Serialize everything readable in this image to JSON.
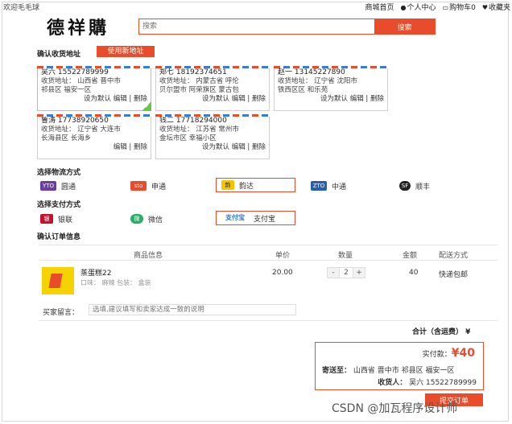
{
  "topbar": {
    "welcome": "欢迎毛毛球",
    "links": [
      "商城首页",
      "个人中心",
      "购物车0",
      "收藏夹"
    ]
  },
  "header": {
    "logo": "德祥購",
    "search_placeholder": "搜索",
    "search_button": "搜索"
  },
  "address": {
    "title": "确认收货地址",
    "new_button": "使用新地址",
    "cards": [
      {
        "name": "吴六 15522789999",
        "line1": "收货地址： 山西省 晋中市",
        "line2": "祁县区 福安一区",
        "actions": [
          "设为默认",
          "编辑",
          "删除"
        ]
      },
      {
        "name": "郑七 18192374651",
        "line1": "收货地址： 内蒙古省 呼伦",
        "line2": "贝尔盟市 阿荣旗区 蒙古包",
        "actions": [
          "设为默认",
          "编辑",
          "删除"
        ]
      },
      {
        "name": "赵一 13145227890",
        "line1": "收货地址： 辽宁省 沈阳市",
        "line2": "铁西区区 和乐苑",
        "actions": [
          "设为默认",
          "编辑",
          "删除"
        ]
      },
      {
        "name": "鲁涛 17738920650",
        "line1": "收货地址： 辽宁省 大连市",
        "line2": "长海县区 长海乡",
        "actions": [
          "编辑",
          "删除"
        ]
      },
      {
        "name": "钱二 17718294000",
        "line1": "收货地址： 江苏省 常州市",
        "line2": "金坛市区 幸福小区",
        "actions": [
          "设为默认",
          "编辑",
          "删除"
        ]
      }
    ]
  },
  "shipping": {
    "title": "选择物流方式",
    "options": [
      {
        "icon": "YTO",
        "label": "圆通",
        "color": "#6b3fa0"
      },
      {
        "icon": "sto",
        "label": "申通",
        "color": "#e84c2b"
      },
      {
        "icon": "韵",
        "label": "韵达",
        "color": "#f5c400"
      },
      {
        "icon": "ZTO",
        "label": "中通",
        "color": "#2a5db0"
      },
      {
        "icon": "SF",
        "label": "顺丰",
        "color": "#222222"
      }
    ]
  },
  "payment": {
    "title": "选择支付方式",
    "options": [
      {
        "icon": "银",
        "label": "银联",
        "color": "#c8102e"
      },
      {
        "icon": "微",
        "label": "微信",
        "color": "#2aae67"
      },
      {
        "icon": "支付宝",
        "label": "支付宝",
        "color": "#1677ff"
      }
    ]
  },
  "order": {
    "title": "确认订单信息",
    "columns": [
      "商品信息",
      "单价",
      "数量",
      "金额",
      "配送方式"
    ],
    "item": {
      "name": "蒸蛋糕22",
      "attrs": "口味： 麻辣 包装： 盒装",
      "price": "20.00",
      "qty": "2",
      "minus": "-",
      "plus": "+",
      "amount": "40",
      "shipping": "快递包邮"
    },
    "message_label": "买家留言：",
    "message_placeholder": "选填,建议填写和卖家达成一致的说明",
    "total_label": "合计（含运费）  ¥"
  },
  "summary": {
    "pay_label": "实付款：",
    "pay_amount": "¥40",
    "send_label": "寄送至：",
    "send_value": "山西省 晋中市 祁县区 福安一区",
    "recv_label": "收货人：",
    "recv_value": "吴六 15522789999",
    "submit": "提交订单"
  },
  "watermark": "CSDN @加瓦程序设计师"
}
